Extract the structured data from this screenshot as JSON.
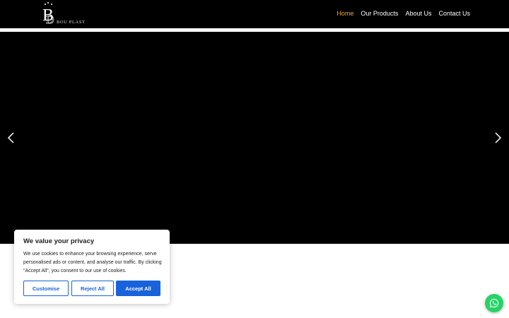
{
  "header": {
    "logo": {
      "monogram": "B",
      "text": "BOU PLAST"
    },
    "nav": [
      {
        "label": "Home",
        "active": true
      },
      {
        "label": "Our Products",
        "active": false
      },
      {
        "label": "About Us",
        "active": false
      },
      {
        "label": "Contact Us",
        "active": false
      }
    ]
  },
  "slider": {
    "prev_icon": "chevron-left-icon",
    "next_icon": "chevron-right-icon"
  },
  "cookie_banner": {
    "title": "We value your privacy",
    "text": "We use cookies to enhance your browsing experience, serve personalised ads or content, and analyse our traffic. By clicking \"Accept All\", you consent to our use of cookies.",
    "customise_label": "Customise",
    "reject_label": "Reject All",
    "accept_label": "Accept All"
  },
  "whatsapp": {
    "icon": "whatsapp-icon"
  },
  "colors": {
    "header_bg": "#000000",
    "nav_active": "#f0a53a",
    "nav_text": "#ffffff",
    "slider_bg": "#000000",
    "button_blue": "#1863dc",
    "whatsapp_green": "#25d366"
  }
}
